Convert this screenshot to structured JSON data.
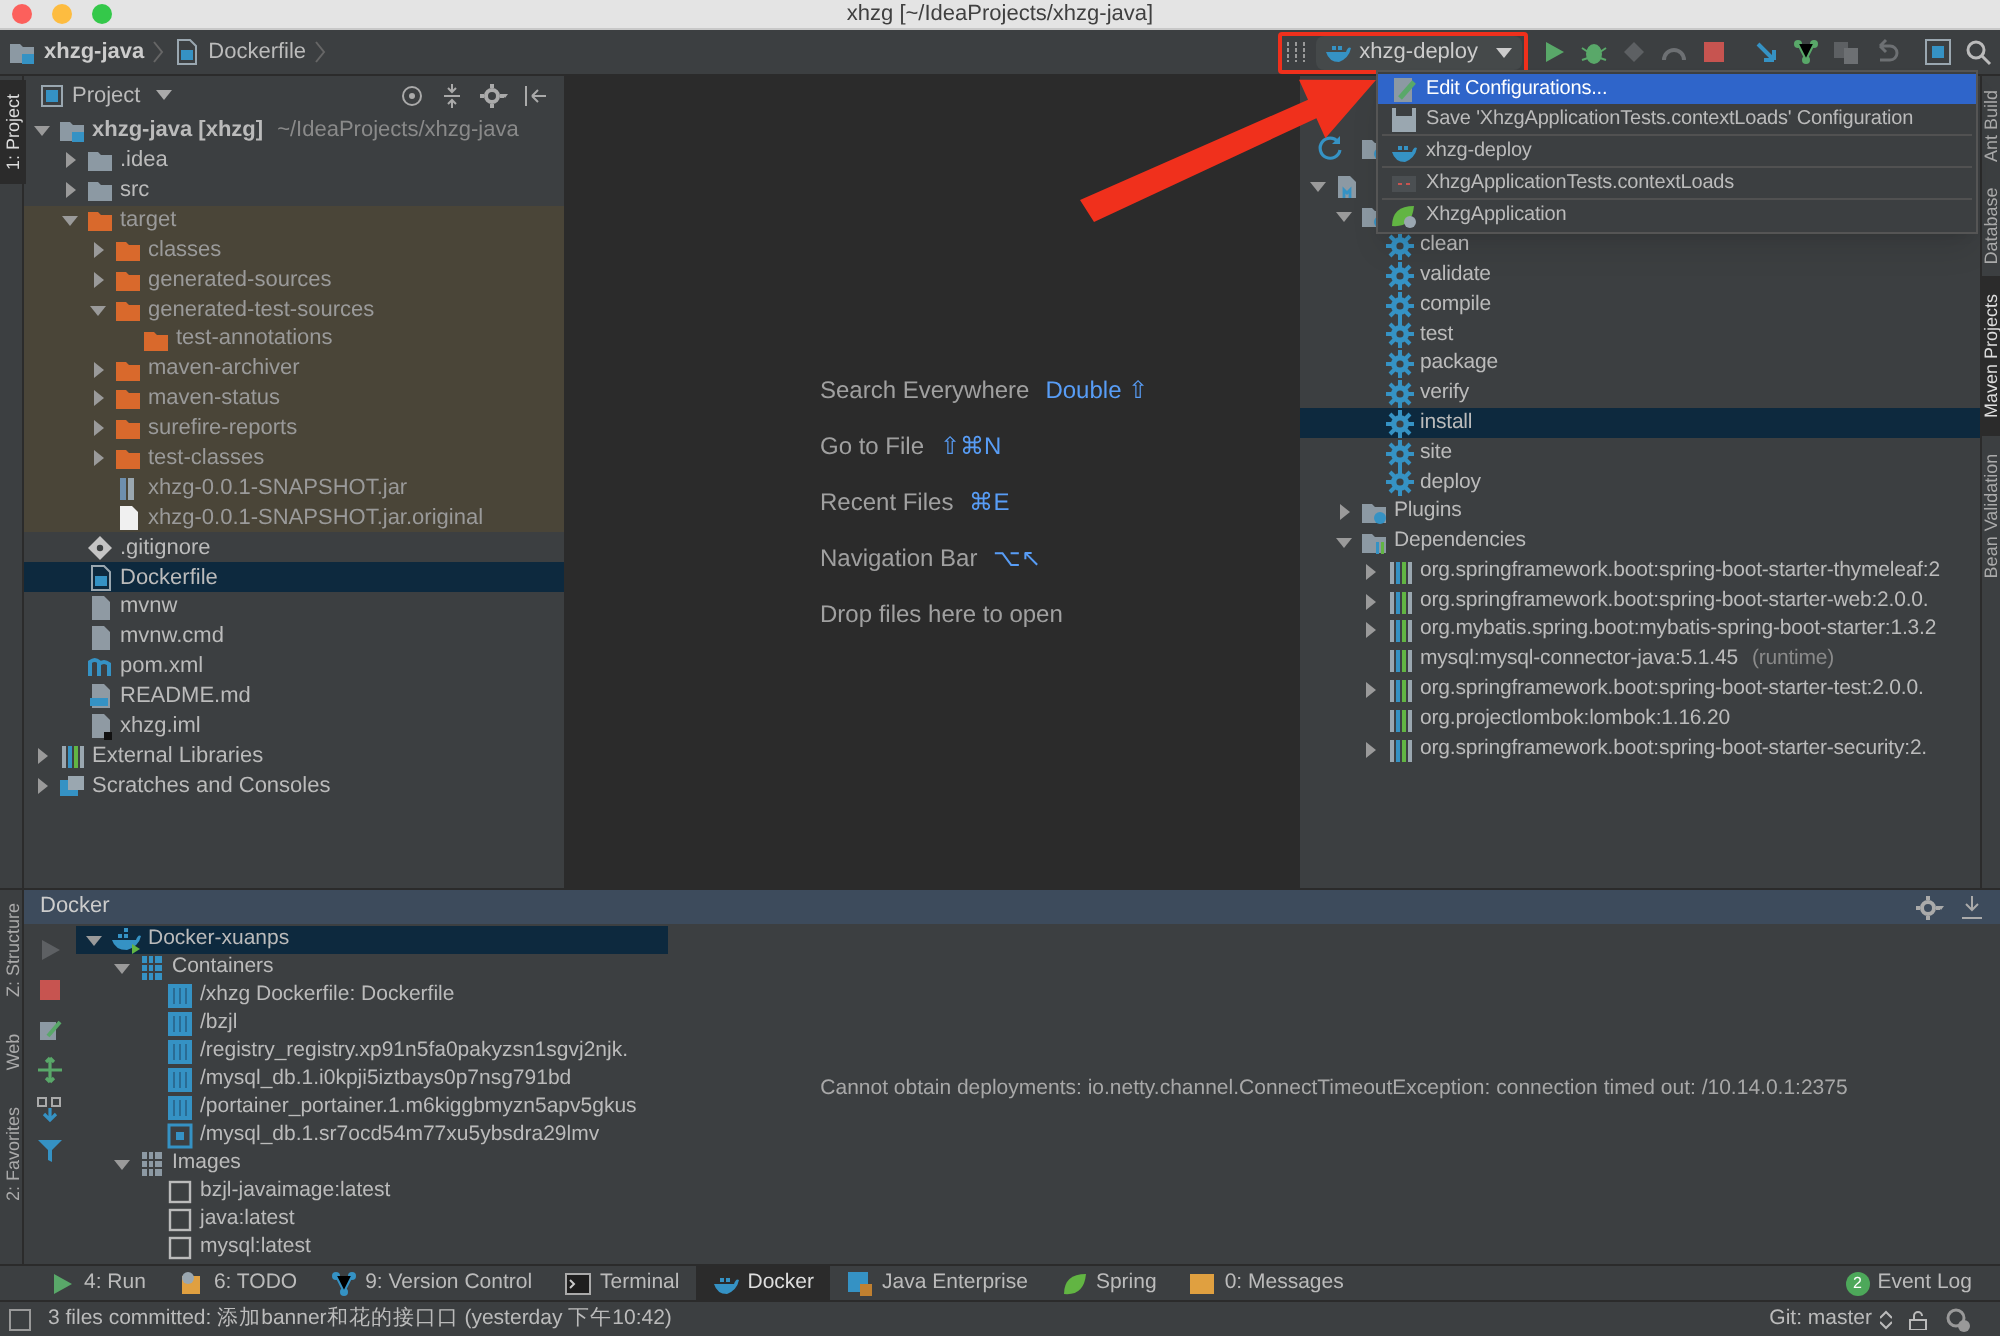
{
  "window": {
    "title": "xhzg [~/IdeaProjects/xhzg-java]"
  },
  "navbar": {
    "breadcrumbs": [
      {
        "label": "xhzg-java",
        "kind": "module"
      },
      {
        "label": "Dockerfile",
        "kind": "dockerfile"
      }
    ],
    "run_config": "xhzg-deploy"
  },
  "run_menu": [
    {
      "label": "Edit Configurations...",
      "kind": "edit",
      "selected": true
    },
    {
      "label": "Save 'XhzgApplicationTests.contextLoads' Configuration",
      "kind": "save",
      "selected": false
    },
    {
      "label": "xhzg-deploy",
      "kind": "docker",
      "selected": false
    },
    {
      "label": "XhzgApplicationTests.contextLoads",
      "kind": "test",
      "selected": false
    },
    {
      "label": "XhzgApplication",
      "kind": "spring",
      "selected": false
    }
  ],
  "left_stripe": {
    "top": [
      {
        "label": "1: Project",
        "selected": true
      }
    ],
    "bottom": [
      {
        "label": "Z: Structure",
        "selected": false
      },
      {
        "label": "Web",
        "selected": false
      },
      {
        "label": "2: Favorites",
        "selected": false
      }
    ]
  },
  "right_stripe": [
    {
      "label": "Ant Build",
      "selected": false
    },
    {
      "label": "Database",
      "selected": false
    },
    {
      "label": "Maven Projects",
      "selected": true
    },
    {
      "label": "Bean Validation",
      "selected": false
    }
  ],
  "project": {
    "title": "Project",
    "tree": [
      {
        "kind": "module",
        "label": "xhzg-java [xhzg]",
        "location": "~/IdeaProjects/xhzg-java",
        "expanded": true,
        "selected": false,
        "children": [
          {
            "kind": "folder",
            "label": ".idea",
            "expanded": false,
            "selected": false
          },
          {
            "kind": "folder",
            "label": "src",
            "expanded": false,
            "selected": false
          },
          {
            "kind": "folder",
            "label": "target",
            "excluded": true,
            "expanded": true,
            "selected": false,
            "children": [
              {
                "kind": "folder",
                "label": "classes",
                "expanded": false,
                "selected": false
              },
              {
                "kind": "folder",
                "label": "generated-sources",
                "expanded": false,
                "selected": false
              },
              {
                "kind": "folder",
                "label": "generated-test-sources",
                "expanded": true,
                "selected": false,
                "children": [
                  {
                    "kind": "folder",
                    "label": "test-annotations",
                    "selected": false
                  }
                ]
              },
              {
                "kind": "folder",
                "label": "maven-archiver",
                "expanded": false,
                "selected": false
              },
              {
                "kind": "folder",
                "label": "maven-status",
                "expanded": false,
                "selected": false
              },
              {
                "kind": "folder",
                "label": "surefire-reports",
                "expanded": false,
                "selected": false
              },
              {
                "kind": "folder",
                "label": "test-classes",
                "expanded": false,
                "selected": false
              },
              {
                "kind": "jar",
                "label": "xhzg-0.0.1-SNAPSHOT.jar",
                "selected": false
              },
              {
                "kind": "file",
                "label": "xhzg-0.0.1-SNAPSHOT.jar.original",
                "selected": false
              }
            ]
          },
          {
            "kind": "git",
            "label": ".gitignore",
            "selected": false
          },
          {
            "kind": "dockerfile",
            "label": "Dockerfile",
            "selected": true
          },
          {
            "kind": "script",
            "label": "mvnw",
            "selected": false
          },
          {
            "kind": "script",
            "label": "mvnw.cmd",
            "selected": false
          },
          {
            "kind": "maven",
            "label": "pom.xml",
            "selected": false
          },
          {
            "kind": "markdown",
            "label": "README.md",
            "selected": false
          },
          {
            "kind": "iml",
            "label": "xhzg.iml",
            "selected": false
          }
        ]
      },
      {
        "kind": "library",
        "label": "External Libraries",
        "expanded": false,
        "selected": false
      },
      {
        "kind": "scratch",
        "label": "Scratches and Consoles",
        "expanded": false,
        "selected": false
      }
    ]
  },
  "editor": {
    "hints": [
      {
        "label": "Search Everywhere",
        "shortcut": "Double ⇧"
      },
      {
        "label": "Go to File",
        "shortcut": "⇧⌘N"
      },
      {
        "label": "Recent Files",
        "shortcut": "⌘E"
      },
      {
        "label": "Navigation Bar",
        "shortcut": "⌥↖"
      },
      {
        "label": "Drop files here to open"
      }
    ]
  },
  "maven": {
    "tree": [
      {
        "kind": "maven-module",
        "expanded": true,
        "selected": false,
        "children": [
          {
            "kind": "lifecycle",
            "expanded": true,
            "selected": false,
            "children": [
              {
                "kind": "goal",
                "label": "clean",
                "selected": false
              },
              {
                "kind": "goal",
                "label": "validate",
                "selected": false
              },
              {
                "kind": "goal",
                "label": "compile",
                "selected": false
              },
              {
                "kind": "goal",
                "label": "test",
                "selected": false
              },
              {
                "kind": "goal",
                "label": "package",
                "selected": false
              },
              {
                "kind": "goal",
                "label": "verify",
                "selected": false
              },
              {
                "kind": "goal",
                "label": "install",
                "selected": true
              },
              {
                "kind": "goal",
                "label": "site",
                "selected": false
              },
              {
                "kind": "goal",
                "label": "deploy",
                "selected": false
              }
            ]
          },
          {
            "kind": "plugins",
            "label": "Plugins",
            "expanded": false,
            "selected": false
          },
          {
            "kind": "dependencies",
            "label": "Dependencies",
            "expanded": true,
            "selected": false,
            "children": [
              {
                "kind": "library",
                "label": "org.springframework.boot:spring-boot-starter-thymeleaf:2",
                "expanded": false,
                "selected": false
              },
              {
                "kind": "library",
                "label": "org.springframework.boot:spring-boot-starter-web:2.0.0.",
                "expanded": false,
                "selected": false
              },
              {
                "kind": "library",
                "label": "org.mybatis.spring.boot:mybatis-spring-boot-starter:1.3.2",
                "expanded": false,
                "selected": false
              },
              {
                "kind": "library",
                "label": "mysql:mysql-connector-java:5.1.45",
                "location": "(runtime)",
                "selected": false
              },
              {
                "kind": "library",
                "label": "org.springframework.boot:spring-boot-starter-test:2.0.0.",
                "expanded": false,
                "selected": false
              },
              {
                "kind": "library",
                "label": "org.projectlombok:lombok:1.16.20",
                "selected": false
              },
              {
                "kind": "library",
                "label": "org.springframework.boot:spring-boot-starter-security:2.",
                "expanded": false,
                "selected": false
              }
            ]
          }
        ]
      }
    ]
  },
  "docker": {
    "title": "Docker",
    "tree": [
      {
        "kind": "docker-host",
        "label": "Docker-xuanps",
        "expanded": true,
        "selected": true,
        "children": [
          {
            "kind": "containers",
            "label": "Containers",
            "expanded": true,
            "selected": false,
            "children": [
              {
                "kind": "container",
                "label": "/xhzg Dockerfile: Dockerfile",
                "selected": false
              },
              {
                "kind": "container",
                "label": "/bzjl",
                "selected": false
              },
              {
                "kind": "container",
                "label": "/registry_registry.xp91n5fa0pakyzsn1sgvj2njk.",
                "selected": false
              },
              {
                "kind": "container",
                "label": "/mysql_db.1.i0kpji5iztbays0p7nsg791bd",
                "selected": false
              },
              {
                "kind": "container",
                "label": "/portainer_portainer.1.m6kiggbmyzn5apv5gkus",
                "selected": false
              },
              {
                "kind": "container-exited",
                "label": "/mysql_db.1.sr7ocd54m77xu5ybsdra29lmv",
                "selected": false
              }
            ]
          },
          {
            "kind": "images",
            "label": "Images",
            "expanded": true,
            "selected": false,
            "children": [
              {
                "kind": "image",
                "label": "bzjl-javaimage:latest",
                "selected": false
              },
              {
                "kind": "image",
                "label": "java:latest",
                "selected": false
              },
              {
                "kind": "image",
                "label": "mysql:latest",
                "selected": false
              }
            ]
          }
        ]
      }
    ],
    "message": "Cannot obtain deployments: io.netty.channel.ConnectTimeoutException: connection timed out: /10.14.0.1:2375"
  },
  "tool_windows": [
    {
      "label": "4: Run",
      "kind": "run",
      "selected": false
    },
    {
      "label": "6: TODO",
      "kind": "todo",
      "selected": false
    },
    {
      "label": "9: Version Control",
      "kind": "vcs",
      "selected": false
    },
    {
      "label": "Terminal",
      "kind": "terminal",
      "selected": false
    },
    {
      "label": "Docker",
      "kind": "docker",
      "selected": true
    },
    {
      "label": "Java Enterprise",
      "kind": "javaee",
      "selected": false
    },
    {
      "label": "Spring",
      "kind": "spring",
      "selected": false
    },
    {
      "label": "0: Messages",
      "kind": "messages",
      "selected": false
    }
  ],
  "event_log": {
    "label": "Event Log",
    "badge": "2"
  },
  "status_bar": {
    "message": "3 files committed: 添加banner和花的接口口 (yesterday 下午10:42)",
    "branch": "Git: master"
  }
}
